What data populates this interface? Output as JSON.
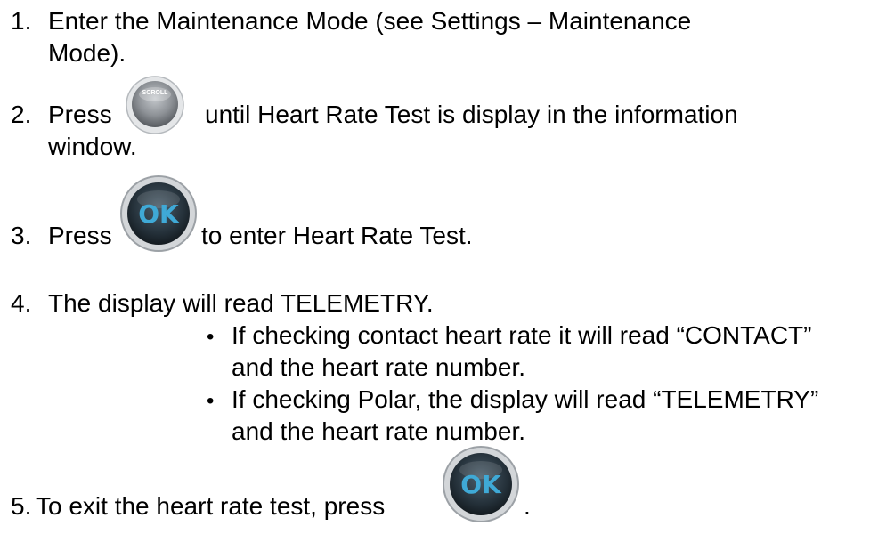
{
  "steps": [
    {
      "number": "1.",
      "line1": "Enter the Maintenance Mode (see Settings – Maintenance",
      "line2": "Mode)."
    },
    {
      "number": "2.",
      "before": "Press",
      "button_icon": "scroll-button-icon",
      "button_text": "SCROLL",
      "after": "until Heart Rate Test is display in the information",
      "line2": "window."
    },
    {
      "number": "3.",
      "before": "Press",
      "button_icon": "ok-button-icon",
      "button_text": "OK",
      "after": "to enter Heart Rate Test."
    },
    {
      "number": "4.",
      "line1": "The display will read TELEMETRY.",
      "bullets": [
        {
          "line1": "If checking contact heart rate it will read “CONTACT”",
          "line2": "and the heart rate number."
        },
        {
          "line1": "If checking Polar, the display will read “TELEMETRY”",
          "line2": "and the heart rate number."
        }
      ]
    },
    {
      "number": "5.",
      "before": "To exit the heart rate test, press",
      "button_icon": "ok-button-icon",
      "button_text": "OK",
      "after": "."
    }
  ],
  "colors": {
    "scroll_button": "#9a9ea3",
    "ok_button": "#2b3a45",
    "ok_text": "#3fa9d6",
    "ring": "#c8ccd0"
  }
}
